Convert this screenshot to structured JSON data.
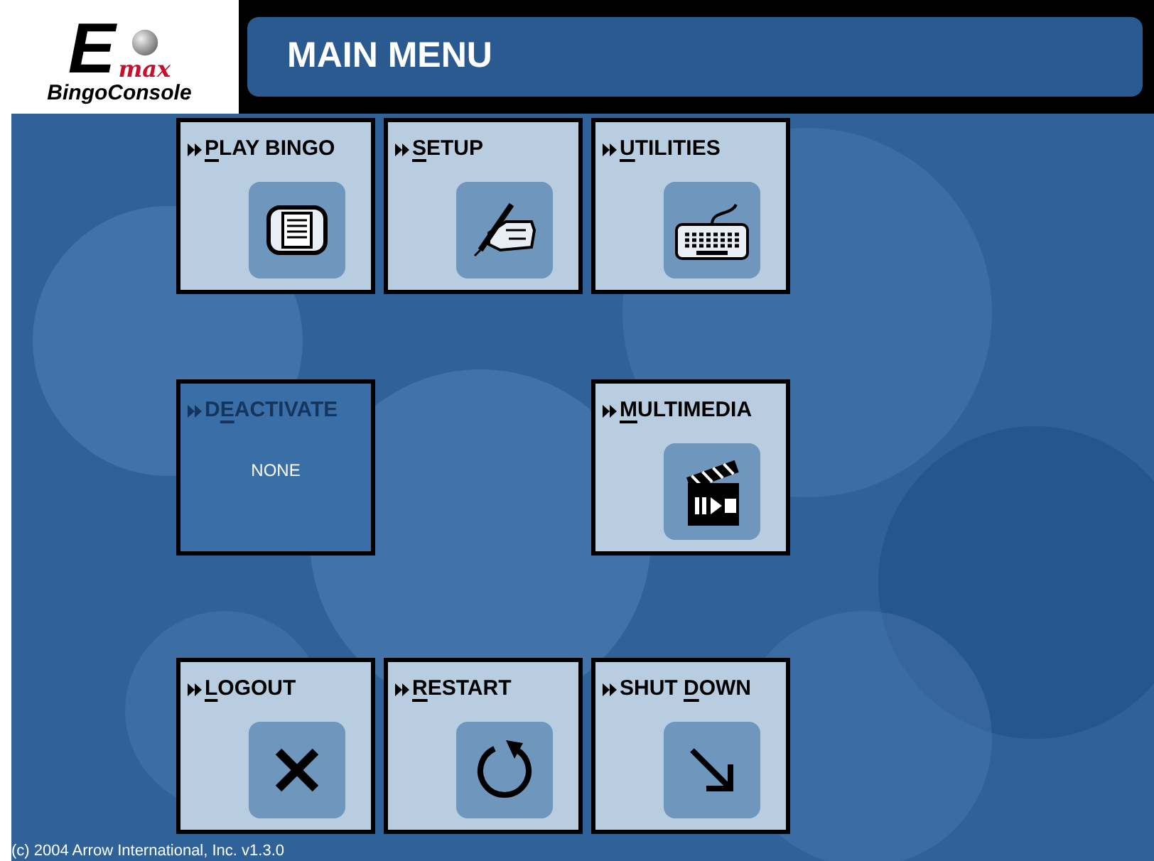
{
  "logo": {
    "letter": "E",
    "script": "max",
    "name": "BingoConsole"
  },
  "title": "MAIN MENU",
  "rows": [
    {
      "cells": [
        {
          "kind": "tile",
          "key": "P",
          "after": "LAY BINGO",
          "disabled": false
        },
        {
          "kind": "tile",
          "key": "S",
          "after": "ETUP",
          "disabled": false
        },
        {
          "kind": "tile",
          "key": "U",
          "after": "TILITIES",
          "disabled": false
        }
      ]
    },
    {
      "cells": [
        {
          "kind": "tile",
          "before": "D",
          "key": "E",
          "after": "ACTIVATE",
          "disabled": true,
          "value": "NONE"
        },
        {
          "kind": "empty"
        },
        {
          "kind": "tile",
          "key": "M",
          "after": "ULTIMEDIA",
          "disabled": false
        }
      ]
    },
    {
      "cells": [
        {
          "kind": "tile",
          "key": "L",
          "after": "OGOUT",
          "disabled": false
        },
        {
          "kind": "tile",
          "key": "R",
          "after": "ESTART",
          "disabled": false
        },
        {
          "kind": "tile",
          "before": "SHUT ",
          "key": "D",
          "after": "OWN",
          "disabled": false
        }
      ]
    }
  ],
  "footer": "(c) 2004 Arrow International, Inc. v1.3.0"
}
